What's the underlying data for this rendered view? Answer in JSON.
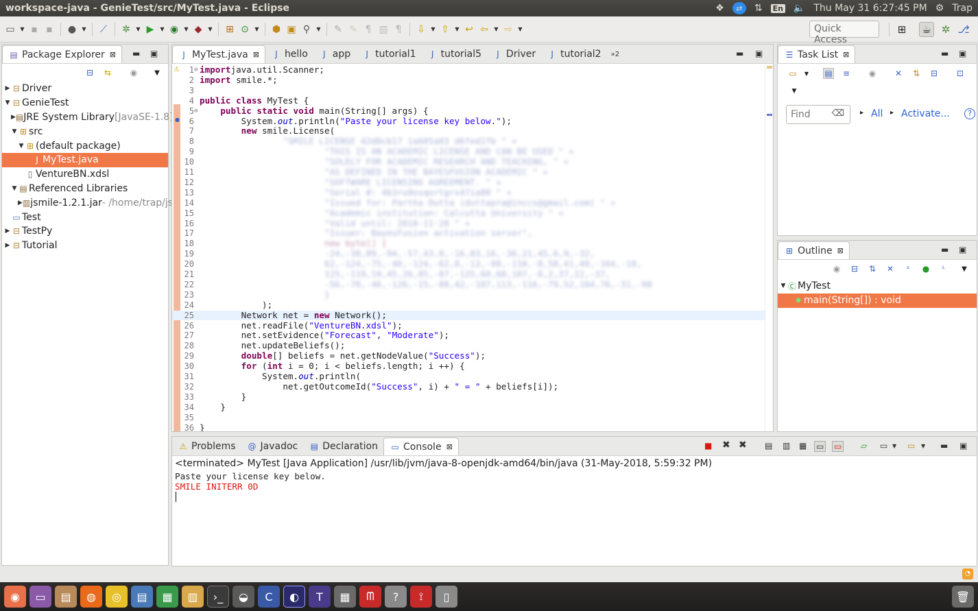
{
  "window": {
    "title": "workspace-java - GenieTest/src/MyTest.java - Eclipse"
  },
  "tray": {
    "lang": "En",
    "clock": "Thu May 31  6:27:45 PM",
    "user": "Trap"
  },
  "toolbar": {
    "quick_access": "Quick Access"
  },
  "colors": {
    "selection": "#f07746",
    "keyword": "#7f0055",
    "string": "#2a00ff",
    "error": "#d9170f"
  },
  "package_explorer": {
    "title": "Package Explorer",
    "items": [
      {
        "label": "Driver",
        "extra": "",
        "depth": 0,
        "expanded": false,
        "icon": "project-icon"
      },
      {
        "label": "GenieTest",
        "extra": "",
        "depth": 0,
        "expanded": true,
        "icon": "project-icon"
      },
      {
        "label": "JRE System Library",
        "extra": "[JavaSE-1.8]",
        "depth": 1,
        "expanded": false,
        "icon": "library-icon"
      },
      {
        "label": "src",
        "extra": "",
        "depth": 1,
        "expanded": true,
        "icon": "source-folder-icon"
      },
      {
        "label": "(default package)",
        "extra": "",
        "depth": 2,
        "expanded": true,
        "icon": "package-icon"
      },
      {
        "label": "MyTest.java",
        "extra": "",
        "depth": 3,
        "expanded": null,
        "icon": "java-file-icon",
        "selected": true
      },
      {
        "label": "VentureBN.xdsl",
        "extra": "",
        "depth": 2,
        "expanded": null,
        "icon": "file-icon"
      },
      {
        "label": "Referenced Libraries",
        "extra": "",
        "depth": 1,
        "expanded": true,
        "icon": "library-icon"
      },
      {
        "label": "jsmile-1.2.1.jar",
        "extra": " - /home/trap/jsmile",
        "depth": 2,
        "expanded": false,
        "icon": "jar-icon"
      },
      {
        "label": "Test",
        "extra": "",
        "depth": 0,
        "expanded": null,
        "icon": "folder-icon"
      },
      {
        "label": "TestPy",
        "extra": "",
        "depth": 0,
        "expanded": false,
        "icon": "project-icon"
      },
      {
        "label": "Tutorial",
        "extra": "",
        "depth": 0,
        "expanded": false,
        "icon": "project-icon"
      }
    ]
  },
  "editor": {
    "tabs": [
      {
        "label": "MyTest.java",
        "active": true
      },
      {
        "label": "hello",
        "active": false
      },
      {
        "label": "app",
        "active": false
      },
      {
        "label": "tutorial1",
        "active": false
      },
      {
        "label": "tutorial5",
        "active": false
      },
      {
        "label": "Driver",
        "active": false
      },
      {
        "label": "tutorial2",
        "active": false
      }
    ],
    "overflow_count": "»2",
    "current_line": 25,
    "lines": [
      {
        "n": "1",
        "fold": "⊖",
        "segs": [
          [
            "kw",
            "import"
          ],
          [
            "",
            "java.util.Scanner;"
          ]
        ]
      },
      {
        "n": "2",
        "fold": "",
        "segs": [
          [
            "kw",
            "import"
          ],
          [
            "",
            " smile.*;"
          ]
        ]
      },
      {
        "n": "3",
        "fold": "",
        "segs": []
      },
      {
        "n": "4",
        "fold": "",
        "segs": [
          [
            "kw",
            "public class"
          ],
          [
            "",
            " MyTest {"
          ]
        ]
      },
      {
        "n": "5",
        "fold": "⊖",
        "segs": [
          [
            "",
            "    "
          ],
          [
            "kw",
            "public static void"
          ],
          [
            "",
            " main(String[] args) {"
          ]
        ]
      },
      {
        "n": "6",
        "fold": "",
        "segs": [
          [
            "",
            "        System."
          ],
          [
            "fld",
            "out"
          ],
          [
            "",
            ".println("
          ],
          [
            "str",
            "\"Paste your license key below.\""
          ],
          [
            "",
            ");"
          ]
        ]
      },
      {
        "n": "7",
        "fold": "",
        "segs": [
          [
            "",
            "        "
          ],
          [
            "kw",
            "new"
          ],
          [
            "",
            " smile.License("
          ]
        ]
      },
      {
        "n": "8",
        "fold": "",
        "segs": [
          [
            "",
            "                "
          ],
          [
            "blur",
            "\"SMILE LICENSE 42d0cb17 1a605a03 d6fed1fb \" +"
          ]
        ]
      },
      {
        "n": "9",
        "fold": "",
        "segs": [
          [
            "",
            "                        "
          ],
          [
            "blur",
            "\"THIS IS AN ACADEMIC LICENSE AND CAN BE USED \" +"
          ]
        ]
      },
      {
        "n": "10",
        "fold": "",
        "segs": [
          [
            "",
            "                        "
          ],
          [
            "blur",
            "\"SOLELY FOR ACADEMIC RESEARCH AND TEACHING, \" +"
          ]
        ]
      },
      {
        "n": "11",
        "fold": "",
        "segs": [
          [
            "",
            "                        "
          ],
          [
            "blur",
            "\"AS DEFINED IN THE BAYESFUSION ACADEMIC \" +"
          ]
        ]
      },
      {
        "n": "12",
        "fold": "",
        "segs": [
          [
            "",
            "                        "
          ],
          [
            "blur",
            "\"SOFTWARE LICENSING AGREEMENT. \" +"
          ]
        ]
      },
      {
        "n": "13",
        "fold": "",
        "segs": [
          [
            "",
            "                        "
          ],
          [
            "blur",
            "\"Serial #: 4b3ru9osqortgrs47ia00 \" +"
          ]
        ]
      },
      {
        "n": "14",
        "fold": "",
        "segs": [
          [
            "",
            "                        "
          ],
          [
            "blur",
            "\"Issued for: Partha Dutta (duttapra@inccs@gmail.com) \" +"
          ]
        ]
      },
      {
        "n": "15",
        "fold": "",
        "segs": [
          [
            "",
            "                        "
          ],
          [
            "blur",
            "\"Academic institution: Calcutta University \" +"
          ]
        ]
      },
      {
        "n": "16",
        "fold": "",
        "segs": [
          [
            "",
            "                        "
          ],
          [
            "blur",
            "\"Valid until: 2018-11-28 \" +"
          ]
        ]
      },
      {
        "n": "17",
        "fold": "",
        "segs": [
          [
            "",
            "                        "
          ],
          [
            "blur",
            "\"Issuer: BayesFusion activation server\","
          ]
        ]
      },
      {
        "n": "18",
        "fold": "",
        "segs": [
          [
            "",
            "                        "
          ],
          [
            "blur-k",
            "new byte[] {"
          ]
        ]
      },
      {
        "n": "19",
        "fold": "",
        "segs": [
          [
            "",
            "                        "
          ],
          [
            "blur",
            "-24,-38,89,-94,-57,43,0,-16,83,16,-36,21,45,6,9,-32,"
          ]
        ]
      },
      {
        "n": "20",
        "fold": "",
        "segs": [
          [
            "",
            "                        "
          ],
          [
            "blur",
            "62,-124,-75,-46,-124,-62,8,-13,-98,-110,-8,58,41,40,-104,-18,"
          ]
        ]
      },
      {
        "n": "21",
        "fold": "",
        "segs": [
          [
            "",
            "                        "
          ],
          [
            "blur",
            "125,-119,19,45,26,85,-87,-125,60,60,107,-8,2,37,22,-37,"
          ]
        ]
      },
      {
        "n": "22",
        "fold": "",
        "segs": [
          [
            "",
            "                        "
          ],
          [
            "blur",
            "-56,-70,-46,-126,-15,-88,42,-107,113,-116,-79,52,104,76,-31,-90"
          ]
        ]
      },
      {
        "n": "23",
        "fold": "",
        "segs": [
          [
            "",
            "                        "
          ],
          [
            "blur",
            "}"
          ]
        ]
      },
      {
        "n": "24",
        "fold": "",
        "segs": [
          [
            "",
            "            );"
          ]
        ]
      },
      {
        "n": "25",
        "fold": "",
        "segs": [
          [
            "",
            "        Network net = "
          ],
          [
            "kw",
            "new"
          ],
          [
            "",
            " Network();"
          ]
        ]
      },
      {
        "n": "26",
        "fold": "",
        "segs": [
          [
            "",
            "        net.readFile("
          ],
          [
            "str",
            "\"VentureBN.xdsl\""
          ],
          [
            "",
            ");"
          ]
        ]
      },
      {
        "n": "27",
        "fold": "",
        "segs": [
          [
            "",
            "        net.setEvidence("
          ],
          [
            "str",
            "\"Forecast\""
          ],
          [
            "",
            ", "
          ],
          [
            "str",
            "\"Moderate\""
          ],
          [
            "",
            ");"
          ]
        ]
      },
      {
        "n": "28",
        "fold": "",
        "segs": [
          [
            "",
            "        net.updateBeliefs();"
          ]
        ]
      },
      {
        "n": "29",
        "fold": "",
        "segs": [
          [
            "",
            "        "
          ],
          [
            "kw",
            "double"
          ],
          [
            "",
            "[] beliefs = net.getNodeValue("
          ],
          [
            "str",
            "\"Success\""
          ],
          [
            "",
            ");"
          ]
        ]
      },
      {
        "n": "30",
        "fold": "",
        "segs": [
          [
            "",
            "        "
          ],
          [
            "kw",
            "for"
          ],
          [
            "",
            " ("
          ],
          [
            "kw",
            "int"
          ],
          [
            "",
            " i = 0; i < beliefs.length; i ++) {"
          ]
        ]
      },
      {
        "n": "31",
        "fold": "",
        "segs": [
          [
            "",
            "            System."
          ],
          [
            "fld",
            "out"
          ],
          [
            "",
            ".println("
          ]
        ]
      },
      {
        "n": "32",
        "fold": "",
        "segs": [
          [
            "",
            "                net.getOutcomeId("
          ],
          [
            "str",
            "\"Success\""
          ],
          [
            "",
            ", i) + "
          ],
          [
            "str",
            "\" = \""
          ],
          [
            "",
            " + beliefs[i]);"
          ]
        ]
      },
      {
        "n": "33",
        "fold": "",
        "segs": [
          [
            "",
            "        }"
          ]
        ]
      },
      {
        "n": "34",
        "fold": "",
        "segs": [
          [
            "",
            "    }"
          ]
        ]
      },
      {
        "n": "35",
        "fold": "",
        "segs": []
      },
      {
        "n": "36",
        "fold": "",
        "segs": [
          [
            "",
            "}"
          ]
        ]
      }
    ]
  },
  "task_list": {
    "title": "Task List",
    "find_placeholder": "Find",
    "all_label": "All",
    "activate_label": "Activate..."
  },
  "outline": {
    "title": "Outline",
    "class_name": "MyTest",
    "method": "main(String[]) : void"
  },
  "console": {
    "tabs": [
      {
        "label": "Problems",
        "icon": "problems-icon",
        "active": false
      },
      {
        "label": "Javadoc",
        "icon": "at-icon",
        "active": false
      },
      {
        "label": "Declaration",
        "icon": "declaration-icon",
        "active": false
      },
      {
        "label": "Console",
        "icon": "console-icon",
        "active": true
      }
    ],
    "status": "<terminated> MyTest [Java Application] /usr/lib/jvm/java-8-openjdk-amd64/bin/java (31-May-2018, 5:59:32 PM)",
    "output_line": "Paste your license key below.",
    "error_line": "SMILE INITERR 0D"
  }
}
